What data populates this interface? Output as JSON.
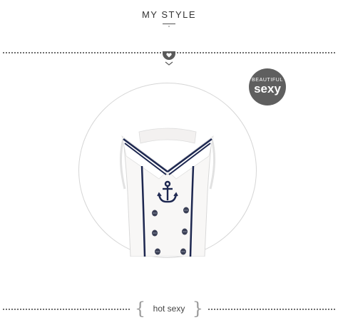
{
  "header": {
    "title": "MY STYLE"
  },
  "badge": {
    "small_text": "BEAUTIFUL",
    "big_text": "sexy",
    "color": "#5f5f5f"
  },
  "caption": {
    "open_brace": "{",
    "text": "hot sexy",
    "close_brace": "}"
  },
  "product": {
    "image": "sailor-top-icon"
  },
  "icons": {
    "divider": "heart-icon",
    "chevron": "chevron-down-icon"
  },
  "colors": {
    "navy": "#1d2750",
    "gray": "#5a5a5a",
    "dots": "#6e6e6e"
  }
}
